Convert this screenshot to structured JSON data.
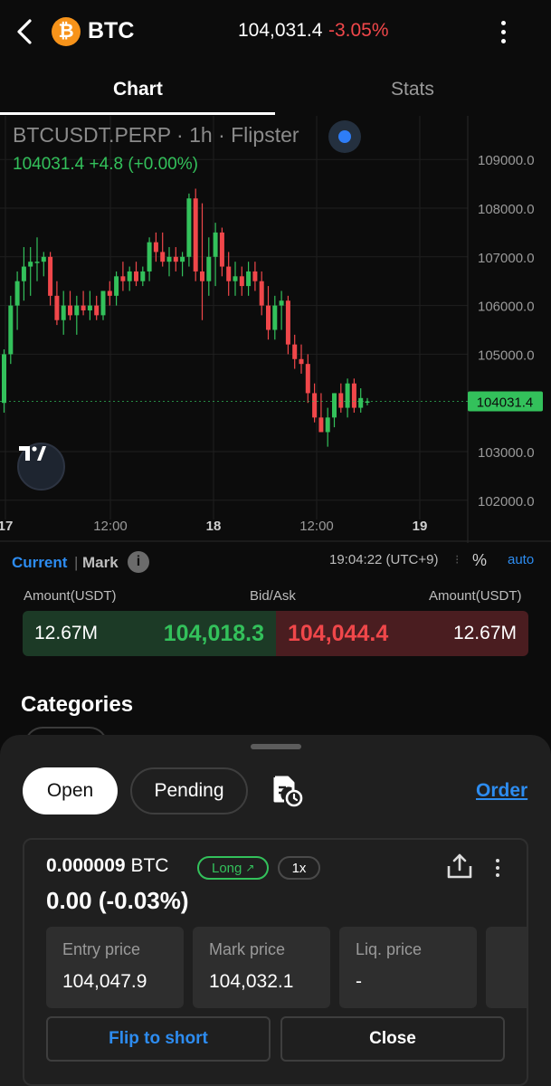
{
  "header": {
    "coin_logo_letter": "₿",
    "symbol": "BTC",
    "price": "104,031.4",
    "change": "-3.05%",
    "colors": {
      "down": "#f0474a",
      "up": "#33c15b",
      "accent": "#2d8cf0",
      "coin": "#f7931a"
    }
  },
  "tabs": [
    {
      "label": "Chart",
      "active": true
    },
    {
      "label": "Stats",
      "active": false
    }
  ],
  "chart": {
    "title": "BTCUSDT.PERP · 1h · Flipster",
    "ohlc": "104031.4  +4.8 (+0.00%)",
    "current_price_tag": "104031.4",
    "y_ticks": [
      "109000.0",
      "108000.0",
      "107000.0",
      "106000.0",
      "105000.0",
      "103000.0",
      "102000.0"
    ],
    "x_ticks": [
      "17",
      "12:00",
      "18",
      "12:00",
      "19"
    ]
  },
  "chart_data": {
    "type": "candlestick",
    "title": "BTCUSDT.PERP · 1h · Flipster",
    "ylim": [
      101900,
      109700
    ],
    "x_labels": [
      "17",
      "12:00",
      "18",
      "12:00",
      "19"
    ],
    "last_price": 104031.4,
    "grid": true,
    "candles": [
      {
        "o": 104000,
        "h": 105100,
        "l": 103800,
        "c": 105000
      },
      {
        "o": 105000,
        "h": 106200,
        "l": 104800,
        "c": 106000
      },
      {
        "o": 106000,
        "h": 106700,
        "l": 105500,
        "c": 106500
      },
      {
        "o": 106500,
        "h": 107200,
        "l": 106100,
        "c": 106800
      },
      {
        "o": 106800,
        "h": 107200,
        "l": 106200,
        "c": 106900
      },
      {
        "o": 106900,
        "h": 107400,
        "l": 106500,
        "c": 106900
      },
      {
        "o": 106900,
        "h": 107100,
        "l": 106600,
        "c": 107000
      },
      {
        "o": 107000,
        "h": 107100,
        "l": 106000,
        "c": 106200
      },
      {
        "o": 106200,
        "h": 106500,
        "l": 105600,
        "c": 105700
      },
      {
        "o": 105700,
        "h": 106300,
        "l": 105400,
        "c": 106000
      },
      {
        "o": 106000,
        "h": 106300,
        "l": 105700,
        "c": 105800
      },
      {
        "o": 105800,
        "h": 106200,
        "l": 105400,
        "c": 106000
      },
      {
        "o": 106000,
        "h": 106300,
        "l": 105800,
        "c": 105900
      },
      {
        "o": 105900,
        "h": 106300,
        "l": 105700,
        "c": 106000
      },
      {
        "o": 106000,
        "h": 106200,
        "l": 105700,
        "c": 105800
      },
      {
        "o": 105800,
        "h": 106300,
        "l": 105700,
        "c": 106300
      },
      {
        "o": 106300,
        "h": 106500,
        "l": 106000,
        "c": 106200
      },
      {
        "o": 106200,
        "h": 106700,
        "l": 106000,
        "c": 106600
      },
      {
        "o": 106600,
        "h": 106900,
        "l": 106300,
        "c": 106500
      },
      {
        "o": 106500,
        "h": 106800,
        "l": 106300,
        "c": 106700
      },
      {
        "o": 106700,
        "h": 106900,
        "l": 106400,
        "c": 106500
      },
      {
        "o": 106500,
        "h": 106800,
        "l": 106400,
        "c": 106700
      },
      {
        "o": 106700,
        "h": 107400,
        "l": 106500,
        "c": 107300
      },
      {
        "o": 107300,
        "h": 107500,
        "l": 106900,
        "c": 107100
      },
      {
        "o": 107100,
        "h": 107500,
        "l": 106800,
        "c": 106900
      },
      {
        "o": 106900,
        "h": 107200,
        "l": 106600,
        "c": 107000
      },
      {
        "o": 107000,
        "h": 107200,
        "l": 106700,
        "c": 106900
      },
      {
        "o": 106900,
        "h": 107100,
        "l": 106600,
        "c": 107000
      },
      {
        "o": 107000,
        "h": 108300,
        "l": 106800,
        "c": 108200
      },
      {
        "o": 108200,
        "h": 108400,
        "l": 106500,
        "c": 106700
      },
      {
        "o": 106700,
        "h": 108100,
        "l": 105700,
        "c": 106500
      },
      {
        "o": 106500,
        "h": 107400,
        "l": 106200,
        "c": 107000
      },
      {
        "o": 107000,
        "h": 107700,
        "l": 106400,
        "c": 107500
      },
      {
        "o": 107500,
        "h": 107600,
        "l": 106600,
        "c": 106800
      },
      {
        "o": 106800,
        "h": 107100,
        "l": 106200,
        "c": 106500
      },
      {
        "o": 106500,
        "h": 106900,
        "l": 106200,
        "c": 106600
      },
      {
        "o": 106600,
        "h": 106800,
        "l": 106200,
        "c": 106400
      },
      {
        "o": 106400,
        "h": 106900,
        "l": 106200,
        "c": 106700
      },
      {
        "o": 106700,
        "h": 106900,
        "l": 106300,
        "c": 106500
      },
      {
        "o": 106500,
        "h": 106700,
        "l": 105800,
        "c": 106000
      },
      {
        "o": 106000,
        "h": 106400,
        "l": 105300,
        "c": 105500
      },
      {
        "o": 105500,
        "h": 106200,
        "l": 105300,
        "c": 106000
      },
      {
        "o": 106000,
        "h": 106300,
        "l": 105500,
        "c": 106100
      },
      {
        "o": 106100,
        "h": 106200,
        "l": 105000,
        "c": 105200
      },
      {
        "o": 105200,
        "h": 105400,
        "l": 104700,
        "c": 104900
      },
      {
        "o": 104900,
        "h": 105200,
        "l": 104600,
        "c": 104800
      },
      {
        "o": 104800,
        "h": 105000,
        "l": 104000,
        "c": 104200
      },
      {
        "o": 104200,
        "h": 104400,
        "l": 103600,
        "c": 103700
      },
      {
        "o": 103700,
        "h": 104200,
        "l": 103400,
        "c": 103400
      },
      {
        "o": 103400,
        "h": 103900,
        "l": 103100,
        "c": 103700
      },
      {
        "o": 103700,
        "h": 104200,
        "l": 103500,
        "c": 104200
      },
      {
        "o": 104200,
        "h": 104400,
        "l": 103800,
        "c": 103900
      },
      {
        "o": 103900,
        "h": 104500,
        "l": 103700,
        "c": 104400
      },
      {
        "o": 104400,
        "h": 104500,
        "l": 103800,
        "c": 103900
      },
      {
        "o": 103900,
        "h": 104300,
        "l": 103800,
        "c": 104100
      },
      {
        "o": 104027,
        "h": 104100,
        "l": 103950,
        "c": 104031.4
      }
    ]
  },
  "market": {
    "current_label": "Current",
    "separator": "|",
    "mark_label": "Mark",
    "info_icon": "i",
    "time": "19:04:22 (UTC+9)",
    "pct_label": "%",
    "auto_label": "auto"
  },
  "bid_ask": {
    "header_left": "Amount(USDT)",
    "header_mid": "Bid/Ask",
    "header_right": "Amount(USDT)",
    "bid_amount": "12.67M",
    "bid_price": "104,018.3",
    "ask_price": "104,044.4",
    "ask_amount": "12.67M"
  },
  "categories_title": "Categories",
  "sheet": {
    "tab_open": "Open",
    "tab_pending": "Pending",
    "order_link": "Order"
  },
  "position": {
    "size_value": "0.000009",
    "size_unit": "BTC",
    "side": "Long",
    "side_icon": "↗",
    "leverage": "1x",
    "pnl": "0.00 (-0.03%)",
    "stats": [
      {
        "label": "Entry price",
        "value": "104,047.9"
      },
      {
        "label": "Mark price",
        "value": "104,032.1"
      },
      {
        "label": "Liq. price",
        "value": "-"
      }
    ],
    "flip_label": "Flip to short",
    "close_label": "Close"
  }
}
